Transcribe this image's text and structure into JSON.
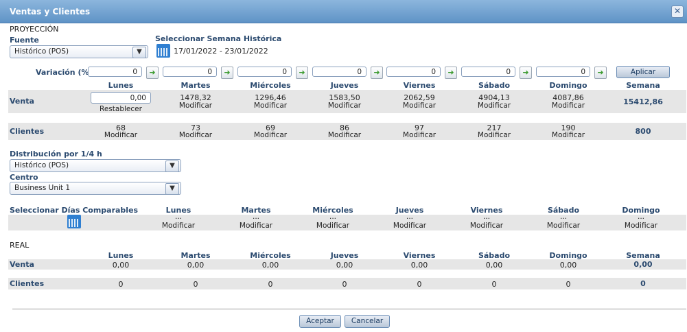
{
  "window": {
    "title": "Ventas y Clientes"
  },
  "proyeccion": {
    "section_title": "PROYECCIÓN",
    "fuente_label": "Fuente",
    "fuente_value": "Histórico (POS)",
    "semana_label": "Seleccionar Semana Histórica",
    "semana_range": "17/01/2022 - 23/01/2022",
    "variacion_label": "Variación (%):",
    "variacion_values": [
      "0",
      "0",
      "0",
      "0",
      "0",
      "0",
      "0"
    ],
    "aplicar_label": "Aplicar",
    "days": [
      "Lunes",
      "Martes",
      "Miércoles",
      "Jueves",
      "Viernes",
      "Sábado",
      "Domingo"
    ],
    "semana_header": "Semana",
    "venta_label": "Venta",
    "venta_lunes_input": "0,00",
    "restablecer_label": "Restablecer",
    "venta_values": [
      "1478,32",
      "1296,46",
      "1583,50",
      "2062,59",
      "4904,13",
      "4087,86"
    ],
    "venta_semana": "15412,86",
    "clientes_label": "Clientes",
    "clientes_values": [
      "68",
      "73",
      "69",
      "86",
      "97",
      "217",
      "190"
    ],
    "clientes_semana": "800",
    "modificar_label": "Modificar"
  },
  "distribucion": {
    "label": "Distribución por 1/4 h",
    "value": "Histórico (POS)",
    "centro_label": "Centro",
    "centro_value": "Business Unit 1"
  },
  "comparables": {
    "label": "Seleccionar Días Comparables",
    "days": [
      "Lunes",
      "Martes",
      "Miércoles",
      "Jueves",
      "Viernes",
      "Sábado",
      "Domingo"
    ],
    "placeholder": "...",
    "modificar_label": "Modificar"
  },
  "real": {
    "section_title": "REAL",
    "days": [
      "Lunes",
      "Martes",
      "Miércoles",
      "Jueves",
      "Viernes",
      "Sábado",
      "Domingo"
    ],
    "semana_header": "Semana",
    "venta_label": "Venta",
    "venta_values": [
      "0,00",
      "0,00",
      "0,00",
      "0,00",
      "0,00",
      "0,00",
      "0,00"
    ],
    "venta_semana": "0,00",
    "clientes_label": "Clientes",
    "clientes_values": [
      "0",
      "0",
      "0",
      "0",
      "0",
      "0",
      "0"
    ],
    "clientes_semana": "0"
  },
  "footer": {
    "aceptar_label": "Aceptar",
    "cancelar_label": "Cancelar"
  }
}
